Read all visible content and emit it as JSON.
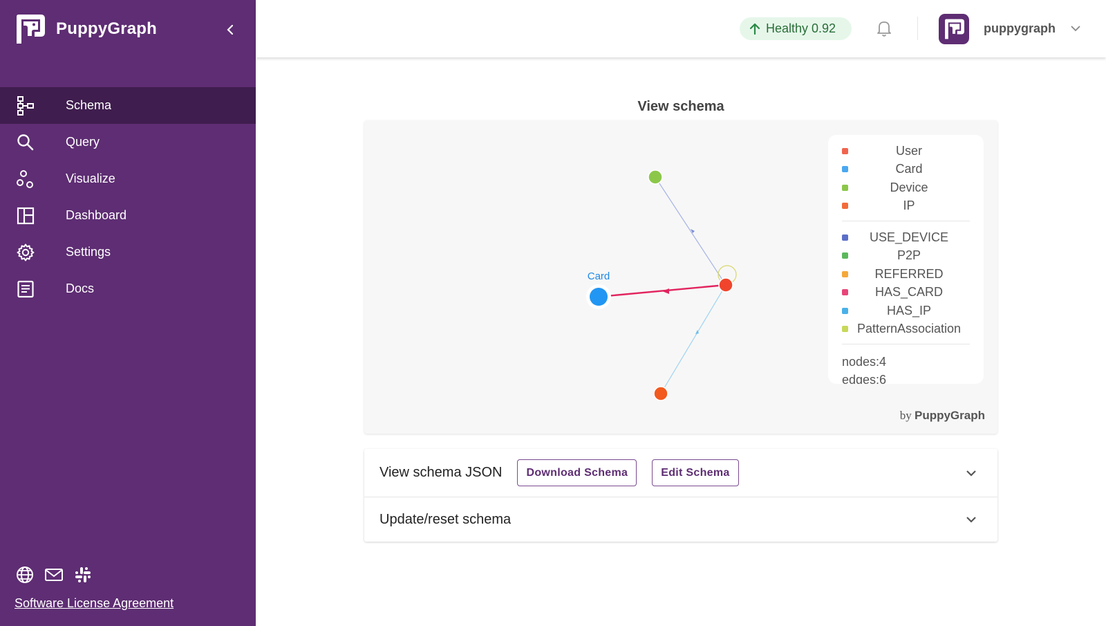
{
  "brand": {
    "name": "PuppyGraph"
  },
  "nav": {
    "items": [
      {
        "label": "Schema",
        "icon": "schema-icon",
        "active": true
      },
      {
        "label": "Query",
        "icon": "search-icon",
        "active": false
      },
      {
        "label": "Visualize",
        "icon": "visualize-icon",
        "active": false
      },
      {
        "label": "Dashboard",
        "icon": "dashboard-icon",
        "active": false
      },
      {
        "label": "Settings",
        "icon": "gear-icon",
        "active": false
      },
      {
        "label": "Docs",
        "icon": "docs-icon",
        "active": false
      }
    ]
  },
  "footer": {
    "license": "Software License Agreement"
  },
  "header": {
    "health": "Healthy 0.92",
    "user": "puppygraph"
  },
  "schema": {
    "title": "View schema",
    "node_label_card": "Card",
    "byline_prefix": "by",
    "byline_brand": "PuppyGraph"
  },
  "legend": {
    "nodes": [
      {
        "label": "User",
        "color": "#f0644e"
      },
      {
        "label": "Card",
        "color": "#4aa8f0"
      },
      {
        "label": "Device",
        "color": "#8cc74a"
      },
      {
        "label": "IP",
        "color": "#f26b3a"
      }
    ],
    "edges": [
      {
        "label": "USE_DEVICE",
        "color": "#5b6fc8"
      },
      {
        "label": "P2P",
        "color": "#5cb85c"
      },
      {
        "label": "REFERRED",
        "color": "#f5a83a"
      },
      {
        "label": "HAS_CARD",
        "color": "#e8457a"
      },
      {
        "label": "HAS_IP",
        "color": "#4ab0e8"
      },
      {
        "label": "PatternAssociation",
        "color": "#c8d85a"
      }
    ],
    "stats": {
      "nodes": "nodes:4",
      "edges": "edges:6"
    }
  },
  "accordion": {
    "json_title": "View schema JSON",
    "download": "Download Schema",
    "edit": "Edit Schema",
    "update_title": "Update/reset schema"
  },
  "colors": {
    "sidebar": "#5e2d73",
    "sidebar_active": "#3f1d4e",
    "health_bg": "#e6f7ea",
    "health_text": "#2a6e38"
  }
}
